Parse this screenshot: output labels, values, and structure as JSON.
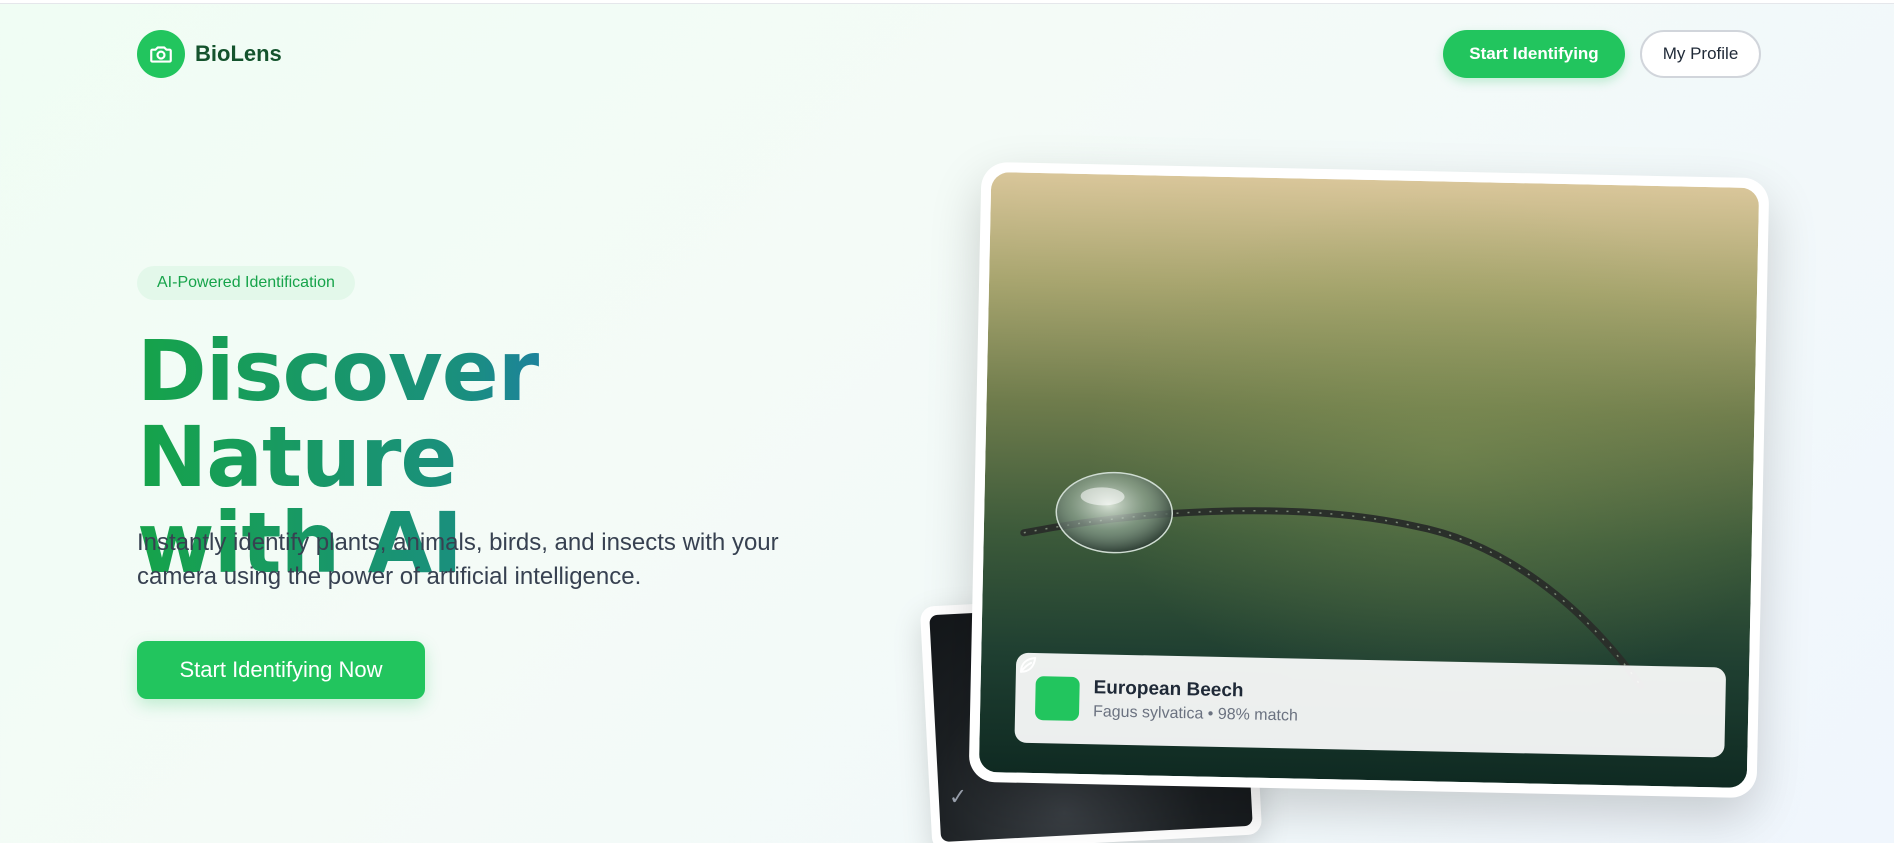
{
  "brand": {
    "name": "BioLens",
    "icon": "camera-icon",
    "accent": "#22c55e"
  },
  "nav": {
    "start_label": "Start Identifying",
    "profile_label": "My Profile"
  },
  "hero": {
    "badge": "AI-Powered Identification",
    "title_line1": "Discover Nature",
    "title_line2": "with AI",
    "subtitle": "Instantly identify plants, animals, birds, and insects with your camera using the power of artificial intelligence.",
    "cta_label": "Start Identifying Now"
  },
  "result": {
    "icon": "leaf-icon",
    "name": "European Beech",
    "scientific_and_match": "Fagus sylvatica • 98% match"
  }
}
